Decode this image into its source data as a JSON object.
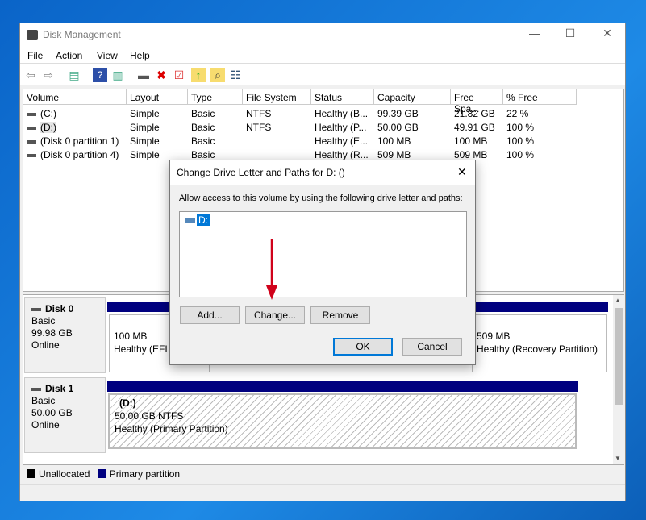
{
  "window": {
    "title": "Disk Management",
    "minimize": "—",
    "maximize": "☐",
    "close": "✕"
  },
  "menu": [
    "File",
    "Action",
    "View",
    "Help"
  ],
  "toolbar": {
    "icons": [
      "back-icon",
      "forward-icon",
      "console-tree-icon",
      "help-icon",
      "action-pane-icon",
      "connect-drive-icon",
      "delete-icon",
      "properties-icon",
      "export-icon",
      "search-icon",
      "list-icon"
    ]
  },
  "table": {
    "columns": [
      "Volume",
      "Layout",
      "Type",
      "File System",
      "Status",
      "Capacity",
      "Free Spa...",
      "% Free"
    ],
    "rows": [
      [
        "(C:)",
        "Simple",
        "Basic",
        "NTFS",
        "Healthy (B...",
        "99.39 GB",
        "21.82 GB",
        "22 %"
      ],
      [
        "(D:)",
        "Simple",
        "Basic",
        "NTFS",
        "Healthy (P...",
        "50.00 GB",
        "49.91 GB",
        "100 %"
      ],
      [
        "(Disk 0 partition 1)",
        "Simple",
        "Basic",
        "",
        "Healthy (E...",
        "100 MB",
        "100 MB",
        "100 %"
      ],
      [
        "(Disk 0 partition 4)",
        "Simple",
        "Basic",
        "",
        "Healthy (R...",
        "509 MB",
        "509 MB",
        "100 %"
      ]
    ]
  },
  "disks": [
    {
      "name": "Disk 0",
      "type": "Basic",
      "size": "99.98 GB",
      "state": "Online",
      "partitions": [
        {
          "size": "100 MB",
          "status": "Healthy (EFI S"
        },
        {
          "size": "509 MB",
          "status": "Healthy (Recovery Partition)"
        }
      ]
    },
    {
      "name": "Disk 1",
      "type": "Basic",
      "size": "50.00 GB",
      "state": "Online",
      "partitions": [
        {
          "label": "(D:)",
          "size": "50.00 GB NTFS",
          "status": "Healthy (Primary Partition)"
        }
      ]
    }
  ],
  "legend": [
    {
      "label": "Unallocated",
      "color": "#000000"
    },
    {
      "label": "Primary partition",
      "color": "#00007f"
    }
  ],
  "dialog": {
    "title": "Change Drive Letter and Paths for D: ()",
    "close": "✕",
    "prompt": "Allow access to this volume by using the following drive letter and paths:",
    "items": [
      "D:"
    ],
    "add": "Add...",
    "change": "Change...",
    "remove": "Remove",
    "ok": "OK",
    "cancel": "Cancel"
  },
  "annotation": {
    "arrow_color": "#d0021b"
  }
}
